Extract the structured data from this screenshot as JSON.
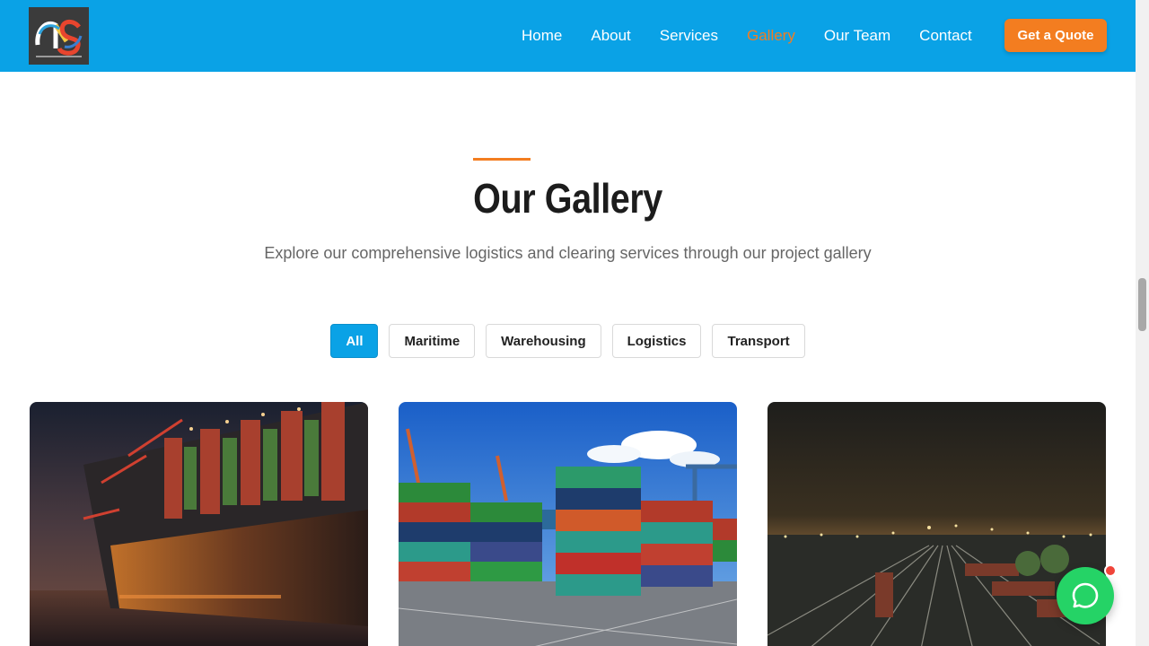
{
  "header": {
    "logo_icon": "company-logo",
    "nav": [
      {
        "label": "Home",
        "active": false
      },
      {
        "label": "About",
        "active": false
      },
      {
        "label": "Services",
        "active": false
      },
      {
        "label": "Gallery",
        "active": true
      },
      {
        "label": "Our Team",
        "active": false
      },
      {
        "label": "Contact",
        "active": false
      }
    ],
    "cta_label": "Get a Quote"
  },
  "gallery": {
    "title": "Our Gallery",
    "subtitle": "Explore our comprehensive logistics and clearing services through our project gallery",
    "filters": [
      {
        "label": "All",
        "active": true
      },
      {
        "label": "Maritime",
        "active": false
      },
      {
        "label": "Warehousing",
        "active": false
      },
      {
        "label": "Logistics",
        "active": false
      },
      {
        "label": "Transport",
        "active": false
      }
    ],
    "images": [
      {
        "subject": "container ship at port at night"
      },
      {
        "subject": "stacked shipping containers at port"
      },
      {
        "subject": "rail yard at night"
      }
    ]
  },
  "chat": {
    "icon": "whatsapp-icon",
    "notification": true
  },
  "colors": {
    "brand_blue": "#0aa2e6",
    "accent_orange": "#f37d20",
    "chat_green": "#25d366"
  }
}
